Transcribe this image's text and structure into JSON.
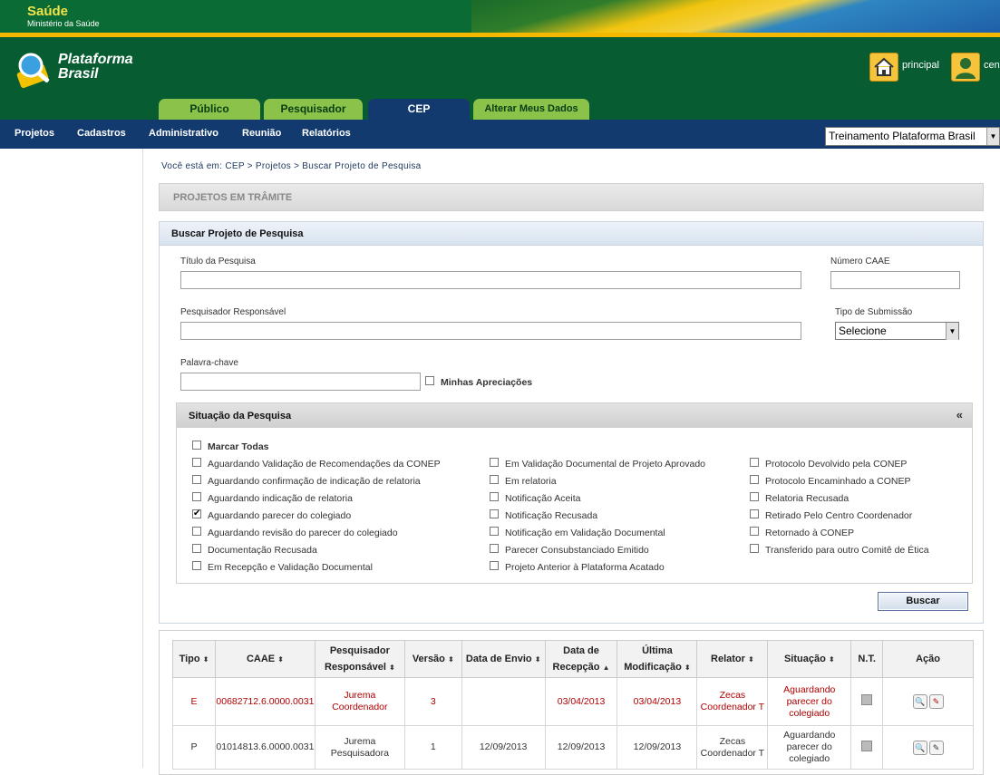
{
  "brand": {
    "saude": "Saúde",
    "ministerio": "Ministério da Saúde",
    "logo_line1": "Plataforma",
    "logo_line2": "Brasil"
  },
  "header": {
    "home_label": "principal",
    "user_label": "cen"
  },
  "tabs": [
    {
      "label": "Público"
    },
    {
      "label": "Pesquisador"
    },
    {
      "label": "CEP"
    },
    {
      "label": "Alterar Meus Dados"
    }
  ],
  "menu": [
    "Projetos",
    "Cadastros",
    "Administrativo",
    "Reunião",
    "Relatórios"
  ],
  "platform_select": "Treinamento Plataforma Brasil",
  "breadcrumb": "Você está em: CEP > Projetos > Buscar Projeto de Pesquisa",
  "section_title": "PROJETOS EM TRÂMITE",
  "search": {
    "title": "Buscar Projeto de Pesquisa",
    "titulo_label": "Título da Pesquisa",
    "caae_label": "Número CAAE",
    "pesq_label": "Pesquisador Responsável",
    "tipo_label": "Tipo de Submissão",
    "tipo_value": "Selecione",
    "palavra_label": "Palavra-chave",
    "minhas_label": "Minhas Apreciações",
    "buscar": "Buscar"
  },
  "situacao": {
    "title": "Situação da Pesquisa",
    "collapse": "«",
    "marcar_todas": "Marcar Todas",
    "col1": [
      {
        "label": "Aguardando Validação de Recomendações da CONEP",
        "checked": false
      },
      {
        "label": "Aguardando confirmação de indicação de relatoria",
        "checked": false
      },
      {
        "label": "Aguardando indicação de relatoria",
        "checked": false
      },
      {
        "label": "Aguardando parecer do colegiado",
        "checked": true
      },
      {
        "label": "Aguardando revisão do parecer do colegiado",
        "checked": false
      },
      {
        "label": "Documentação Recusada",
        "checked": false
      },
      {
        "label": "Em Recepção e Validação Documental",
        "checked": false
      }
    ],
    "col2": [
      {
        "label": "Em Validação Documental de Projeto Aprovado",
        "checked": false
      },
      {
        "label": "Em relatoria",
        "checked": false
      },
      {
        "label": "Notificação Aceita",
        "checked": false
      },
      {
        "label": "Notificação Recusada",
        "checked": false
      },
      {
        "label": "Notificação em Validação Documental",
        "checked": false
      },
      {
        "label": "Parecer Consubstanciado Emitido",
        "checked": false
      },
      {
        "label": "Projeto Anterior à Plataforma Acatado",
        "checked": false
      }
    ],
    "col3": [
      {
        "label": "Protocolo Devolvido pela CONEP",
        "checked": false
      },
      {
        "label": "Protocolo Encaminhado a CONEP",
        "checked": false
      },
      {
        "label": "Relatoria Recusada",
        "checked": false
      },
      {
        "label": "Retirado Pelo Centro Coordenador",
        "checked": false
      },
      {
        "label": "Retornado à CONEP",
        "checked": false
      },
      {
        "label": "Transferido para outro Comitê de Ética",
        "checked": false
      }
    ]
  },
  "table": {
    "headers": [
      "Tipo",
      "CAAE",
      "Pesquisador Responsável",
      "Versão",
      "Data de Envio",
      "Data de Recepção",
      "Última Modificação",
      "Relator",
      "Situação",
      "N.T.",
      "Ação"
    ],
    "rows": [
      {
        "tipo": "E",
        "caae": "00682712.6.0000.0031",
        "pesquisador": "Jurema Coordenador",
        "versao": "3",
        "envio": "",
        "recepcao": "03/04/2013",
        "modificacao": "03/04/2013",
        "relator": "Zecas Coordenador T",
        "situacao": "Aguardando parecer do colegiado"
      },
      {
        "tipo": "P",
        "caae": "01014813.6.0000.0031",
        "pesquisador": "Jurema Pesquisadora",
        "versao": "1",
        "envio": "12/09/2013",
        "recepcao": "12/09/2013",
        "modificacao": "12/09/2013",
        "relator": "Zecas Coordenador T",
        "situacao": "Aguardando parecer do colegiado"
      }
    ]
  }
}
